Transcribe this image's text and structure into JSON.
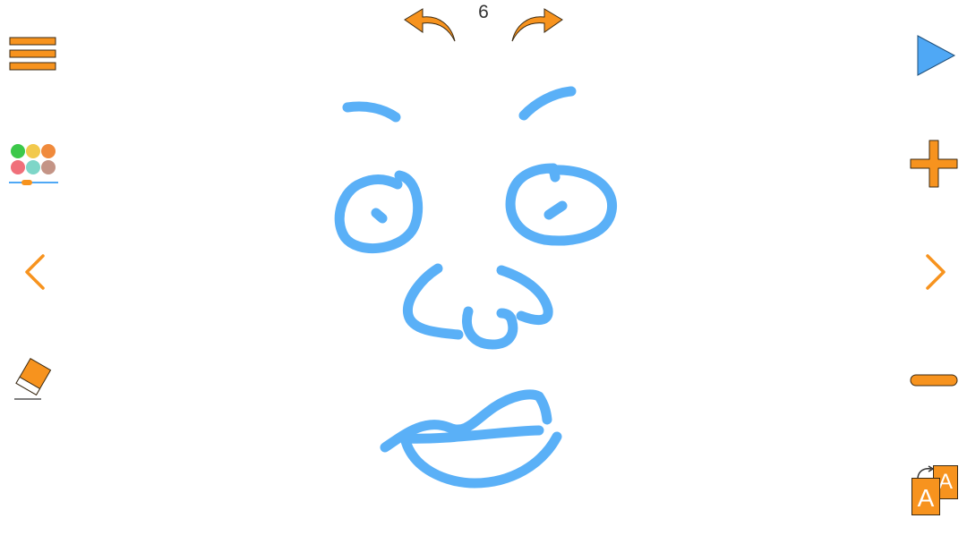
{
  "page_number": "6",
  "colors": {
    "accent": "#F7931E",
    "accent_outline": "#3a2a14",
    "play": "#4FA8F5",
    "ink": "#5AB0F7",
    "palette": [
      "#3CC84A",
      "#F2C94C",
      "#F08A3C",
      "#F0707A",
      "#7ED6C8",
      "#C49486"
    ]
  },
  "toolbar_left": {
    "menu_icon": "hamburger-menu-icon",
    "palette_icon": "color-palette-icon",
    "prev_icon": "chevron-left-icon",
    "eraser_icon": "eraser-icon"
  },
  "toolbar_right": {
    "play_icon": "play-icon",
    "add_icon": "plus-icon",
    "next_icon": "chevron-right-icon",
    "remove_icon": "minus-icon",
    "font_icon": "font-switch-icon",
    "font_letters": [
      "A",
      "A"
    ]
  },
  "toolbar_top": {
    "undo_icon": "undo-arrow-icon",
    "redo_icon": "redo-arrow-icon"
  }
}
